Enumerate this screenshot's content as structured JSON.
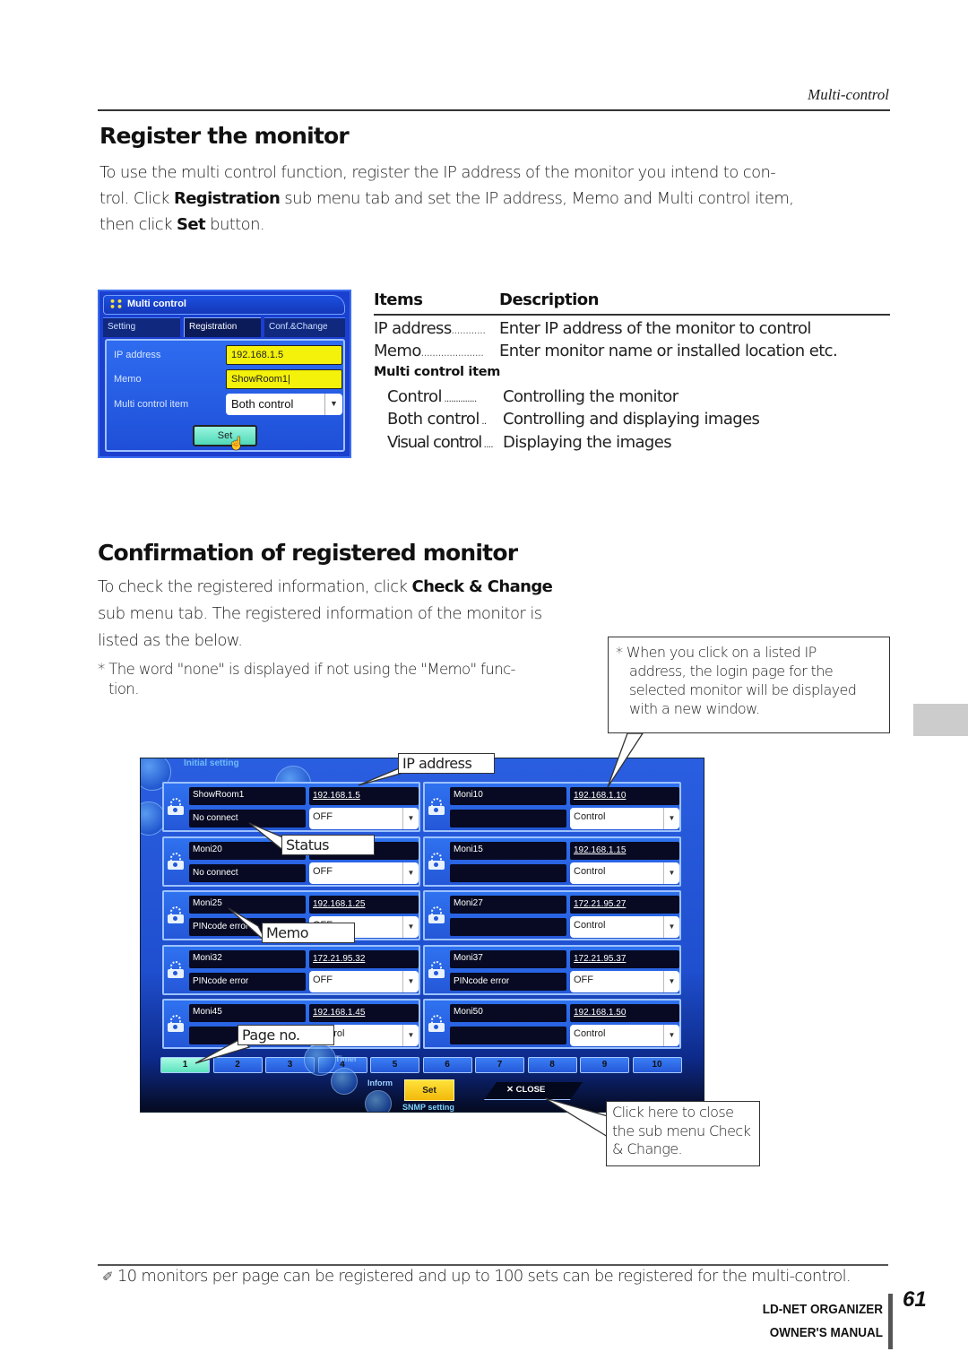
{
  "header": {
    "running_head": "Multi-control"
  },
  "register": {
    "title": "Register the monitor",
    "para": {
      "t1": "To use the multi control function, register the IP address of the monitor you intend to con-",
      "t2": "trol. Click ",
      "b1": "Registration",
      "t3": " sub menu tab and set the IP address, Memo and Multi control item,",
      "t4": "then click ",
      "b2": "Set",
      "t5": " button."
    },
    "screenshot": {
      "panel_title": "Multi control",
      "tabs": [
        "Setting",
        "Registration",
        "Conf.&Change"
      ],
      "active_tab": "Registration",
      "fields": {
        "ip_label": "IP address",
        "ip_value": "192.168.1.5",
        "memo_label": "Memo",
        "memo_value": "ShowRoom1|",
        "item_label": "Multi control item",
        "item_value": "Both control"
      },
      "set_label": "Set"
    },
    "table": {
      "col_items": "Items",
      "col_desc": "Description",
      "rows": [
        {
          "item": "IP address",
          "dots": "............",
          "desc": "Enter IP address of the monitor to control"
        },
        {
          "item": "Memo",
          "dots": "......................",
          "desc": "Enter monitor name or installed location etc."
        }
      ],
      "subheading": "Multi control item",
      "sub_rows": [
        {
          "item": "Control",
          "dots": " ..............",
          "desc": "Controlling the monitor"
        },
        {
          "item": "Both control",
          "dots": " ..",
          "desc": "Controlling and displaying images"
        },
        {
          "item": "Visual control",
          "dots": " ....",
          "desc": "Displaying the images"
        }
      ]
    }
  },
  "confirm": {
    "title": "Confirmation of registered monitor",
    "para": {
      "t1": "To check the registered information, click ",
      "b1": "Check & Change",
      "t2": "sub menu tab. The registered information of the monitor is",
      "t3": "listed as the below."
    },
    "note": "* The word \"none\" is displayed if not using the \"Memo\" func-",
    "note2": "tion.",
    "callout_click": [
      "* When you click on a listed IP",
      "address,  the login page for the",
      "selected monitor will be displayed",
      "with a new window."
    ],
    "labels": {
      "ip_address": "IP address",
      "status": "Status",
      "memo": "Memo",
      "page_no": "Page no.",
      "close_hint": [
        "Click here to close",
        "the sub menu Check",
        "& Change."
      ]
    },
    "screenshot": {
      "initial_setting": "Initial setting",
      "monitors_left": [
        {
          "memo": "ShowRoom1",
          "status": "No connect",
          "ip": "192.168.1.5",
          "mode": "OFF"
        },
        {
          "memo": "Moni20",
          "status": "No connect",
          "ip": "",
          "mode": "OFF"
        },
        {
          "memo": "Moni25",
          "status": "PINcode error",
          "ip": "192.168.1.25",
          "mode": "OFF"
        },
        {
          "memo": "Moni32",
          "status": "PINcode error",
          "ip": "172.21.95.32",
          "mode": "OFF"
        },
        {
          "memo": "Moni45",
          "status": "",
          "ip": "192.168.1.45",
          "mode": "Control"
        }
      ],
      "monitors_right": [
        {
          "memo": "Moni10",
          "status": "",
          "ip": "192.168.1.10",
          "mode": "Control"
        },
        {
          "memo": "Moni15",
          "status": "",
          "ip": "192.168.1.15",
          "mode": "Control"
        },
        {
          "memo": "Moni27",
          "status": "",
          "ip": "172.21.95.27",
          "mode": "Control"
        },
        {
          "memo": "Moni37",
          "status": "PINcode error",
          "ip": "172.21.95.37",
          "mode": "OFF"
        },
        {
          "memo": "Moni50",
          "status": "",
          "ip": "192.168.1.50",
          "mode": "Control"
        }
      ],
      "pages": [
        "1",
        "2",
        "3",
        "4",
        "5",
        "6",
        "7",
        "8",
        "9",
        "10"
      ],
      "active_page": "1",
      "timer": "Timer",
      "inform": "Inform",
      "set_label": "Set",
      "close_label": "✕ CLOSE",
      "snmp_label": "SNMP setting"
    }
  },
  "footer": {
    "note_icon": "pencil-icon",
    "note": "10 monitors per page can be registered and up to 100 sets can be registered for the multi-control.",
    "product": "LD-NET ORGANIZER",
    "manual": "OWNER'S MANUAL",
    "page_number": "61"
  },
  "colors": {
    "screen_blue": "#1f4fcf",
    "field_yellow": "#f4f10a",
    "active_page_green": "#5de2bd",
    "set_yellow": "#f2b90a",
    "side_tab_gray": "#cccccc"
  }
}
